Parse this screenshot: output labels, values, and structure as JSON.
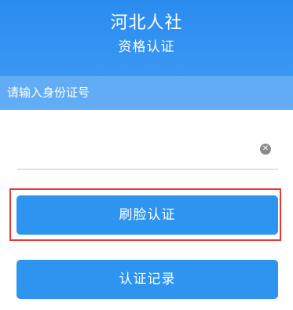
{
  "header": {
    "title": "河北人社",
    "subtitle": "资格认证"
  },
  "id_section": {
    "label": "请输入身份证号",
    "input_value": "",
    "clear_glyph": "✕"
  },
  "buttons": {
    "face_auth": "刷脸认证",
    "auth_records": "认证记录"
  },
  "colors": {
    "header_blue": "#2a8cf0",
    "label_bar_blue": "#62acf6",
    "button_blue": "#2d94f0",
    "highlight_red": "#e53935"
  }
}
